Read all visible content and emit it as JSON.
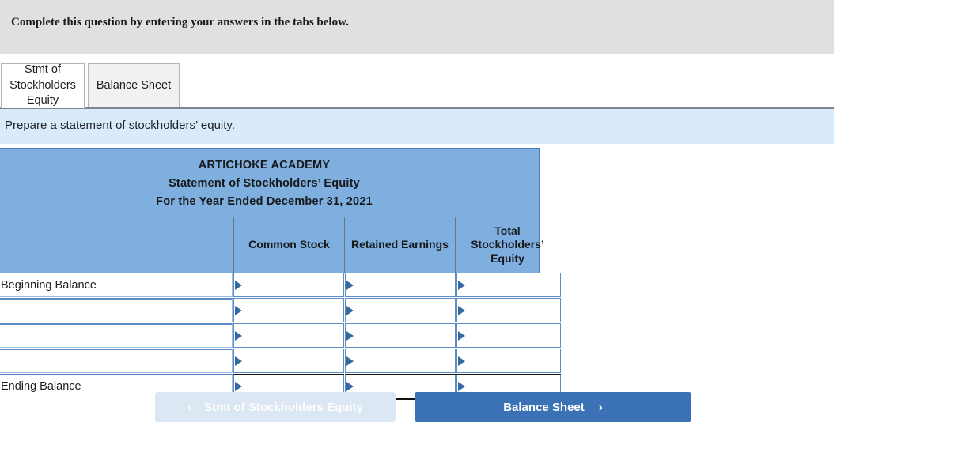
{
  "question_bar": {
    "instruction": "Complete this question by entering your answers in the tabs below."
  },
  "tabs": [
    {
      "label": "Stmt of Stockholders Equity",
      "active": true
    },
    {
      "label": "Balance Sheet",
      "active": false
    }
  ],
  "requirement": {
    "text": "Prepare a statement of stockholders’ equity."
  },
  "worksheet": {
    "title_line1": "ARTICHOKE ACADEMY",
    "title_line2": "Statement of Stockholders’ Equity",
    "title_line3": "For the Year Ended December 31, 2021",
    "columns": [
      {
        "label": "Common Stock"
      },
      {
        "label": "Retained Earnings"
      },
      {
        "label": "Total Stockholders’ Equity"
      }
    ],
    "rows": [
      {
        "label": "Beginning Balance",
        "common_stock": "",
        "retained_earnings": "",
        "total_equity": "",
        "total_row": false
      },
      {
        "label": "",
        "common_stock": "",
        "retained_earnings": "",
        "total_equity": "",
        "total_row": false
      },
      {
        "label": "",
        "common_stock": "",
        "retained_earnings": "",
        "total_equity": "",
        "total_row": false
      },
      {
        "label": "",
        "common_stock": "",
        "retained_earnings": "",
        "total_equity": "",
        "total_row": false
      },
      {
        "label": "Ending Balance",
        "common_stock": "",
        "retained_earnings": "",
        "total_equity": "",
        "total_row": true
      }
    ]
  },
  "nav": {
    "prev_label": "Stmt of Stockholders Equity",
    "prev_chevron": "‹",
    "prev_disabled": true,
    "next_label": "Balance Sheet",
    "next_chevron": "›"
  },
  "colors": {
    "header_bar": "#e0e0e0",
    "requirement_bar": "#d9ebfa",
    "sheet_header": "#7eafdf",
    "cell_border": "#5b8cc4",
    "next_button": "#3a72b5",
    "prev_button": "#dbe7f3"
  }
}
